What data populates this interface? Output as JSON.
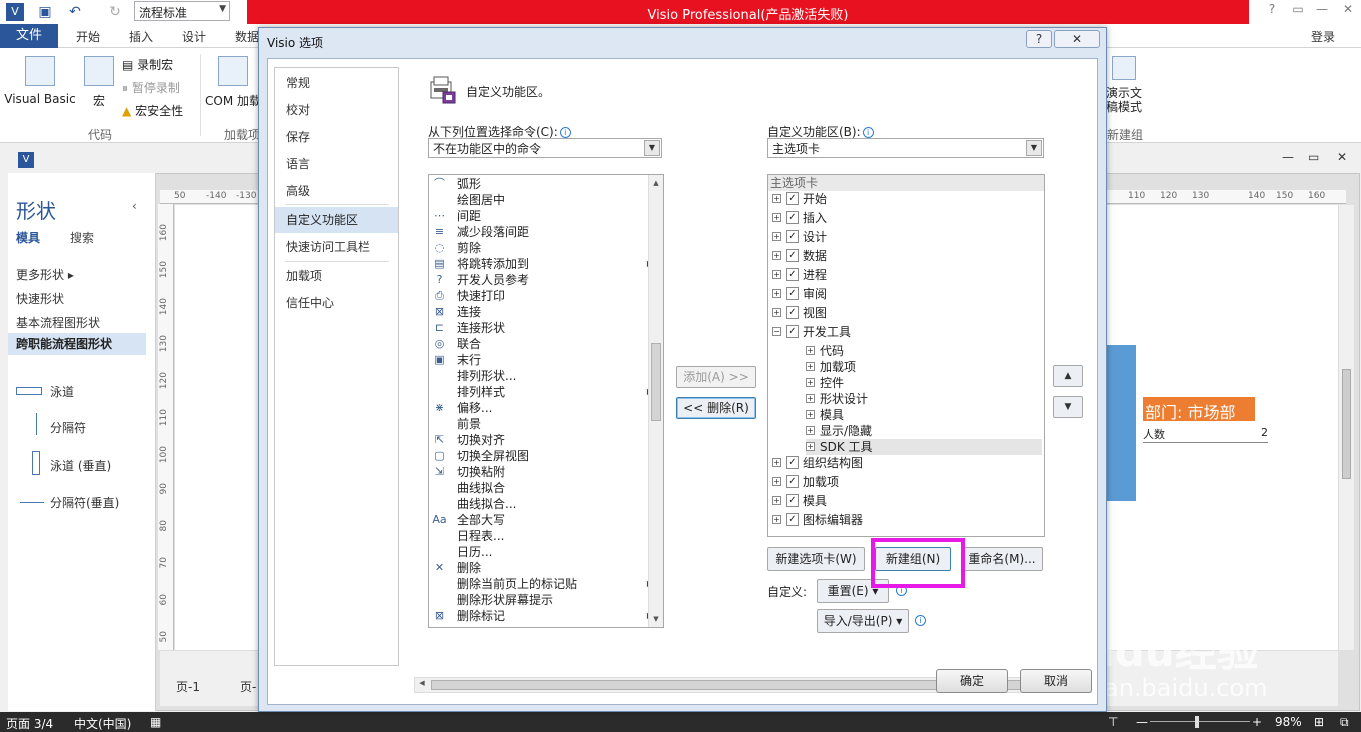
{
  "app": {
    "window_title": "Visio Professional(产品激活失败)",
    "quick_style": "流程标准",
    "ribbon_tabs": [
      "开始",
      "插入",
      "设计",
      "数据"
    ],
    "file_tab": "文件",
    "login": "登录"
  },
  "ribbon": {
    "visual_basic": "Visual Basic",
    "macro": "宏",
    "record_macro": "录制宏",
    "pause_record": "暂停录制",
    "macro_security": "宏安全性",
    "com_addins": "COM 加载",
    "group_code": "代码",
    "group_addins": "加载项",
    "present_mode": "演示文稿模式",
    "new_group_label": "新建组"
  },
  "shapes_panel": {
    "title": "形状",
    "tab_stencils": "模具",
    "tab_search": "搜索",
    "more_shapes": "更多形状",
    "quick_shapes": "快速形状",
    "basic_flowchart": "基本流程图形状",
    "cross_functional": "跨职能流程图形状",
    "items": [
      "泳道",
      "分隔符",
      "泳道 (垂直)",
      "分隔符(垂直)"
    ]
  },
  "canvas": {
    "ruler_top": [
      "50",
      "-140",
      "-130",
      "110",
      "120",
      "130",
      "140",
      "150",
      "160"
    ],
    "ruler_left": [
      "160",
      "150",
      "140",
      "130",
      "120",
      "110",
      "100",
      "90",
      "80",
      "70",
      "60",
      "50"
    ],
    "dept_label": "部门:  市场部",
    "count_label": "人数",
    "count_value": "2",
    "page_tabs": [
      "页-1",
      "页-"
    ]
  },
  "statusbar": {
    "page": "页面 3/4",
    "language": "中文(中国)",
    "zoom": "98%"
  },
  "dialog": {
    "title": "Visio 选项",
    "help": "?",
    "close": "✕",
    "nav": [
      "常规",
      "校对",
      "保存",
      "语言",
      "高级",
      "自定义功能区",
      "快速访问工具栏",
      "加载项",
      "信任中心"
    ],
    "nav_selected": "自定义功能区",
    "heading": "自定义功能区。",
    "choose_from_label": "从下列位置选择命令(C):",
    "choose_from_value": "不在功能区中的命令",
    "customize_label": "自定义功能区(B):",
    "customize_value": "主选项卡",
    "commands": [
      {
        "icon": "⌒",
        "label": "弧形",
        "sub": false
      },
      {
        "icon": "",
        "label": "绘图居中",
        "sub": false
      },
      {
        "icon": "⋯",
        "label": "间距",
        "sub": false
      },
      {
        "icon": "≡",
        "label": "减少段落间距",
        "sub": false
      },
      {
        "icon": "◌",
        "label": "剪除",
        "sub": false
      },
      {
        "icon": "▤",
        "label": "将跳转添加到",
        "sub": true
      },
      {
        "icon": "?",
        "label": "开发人员参考",
        "sub": false
      },
      {
        "icon": "⎙",
        "label": "快速打印",
        "sub": false
      },
      {
        "icon": "⊠",
        "label": "连接",
        "sub": false
      },
      {
        "icon": "⊏",
        "label": "连接形状",
        "sub": false
      },
      {
        "icon": "◎",
        "label": "联合",
        "sub": false
      },
      {
        "icon": "▣",
        "label": "末行",
        "sub": false
      },
      {
        "icon": "",
        "label": "排列形状...",
        "sub": false
      },
      {
        "icon": "",
        "label": "排列样式",
        "sub": true
      },
      {
        "icon": "⋇",
        "label": "偏移...",
        "sub": false
      },
      {
        "icon": "",
        "label": "前景",
        "sub": false
      },
      {
        "icon": "⇱",
        "label": "切换对齐",
        "sub": false
      },
      {
        "icon": "▢",
        "label": "切换全屏视图",
        "sub": false
      },
      {
        "icon": "⇲",
        "label": "切换粘附",
        "sub": false
      },
      {
        "icon": "",
        "label": "曲线拟合",
        "sub": false
      },
      {
        "icon": "",
        "label": "曲线拟合...",
        "sub": false
      },
      {
        "icon": "Aa",
        "label": "全部大写",
        "sub": false
      },
      {
        "icon": "",
        "label": "日程表...",
        "sub": false
      },
      {
        "icon": "",
        "label": "日历...",
        "sub": false
      },
      {
        "icon": "✕",
        "label": "删除",
        "sub": false
      },
      {
        "icon": "",
        "label": "删除当前页上的标记贴",
        "sub": true
      },
      {
        "icon": "",
        "label": "删除形状屏幕提示",
        "sub": false
      },
      {
        "icon": "⊠",
        "label": "删除标记",
        "sub": true
      }
    ],
    "add_button": "添加(A) >>",
    "remove_button": "<< 删除(R)",
    "tree_header": "主选项卡",
    "tree": [
      {
        "level": 0,
        "pm": "+",
        "checked": true,
        "label": "开始"
      },
      {
        "level": 0,
        "pm": "+",
        "checked": true,
        "label": "插入"
      },
      {
        "level": 0,
        "pm": "+",
        "checked": true,
        "label": "设计"
      },
      {
        "level": 0,
        "pm": "+",
        "checked": true,
        "label": "数据"
      },
      {
        "level": 0,
        "pm": "+",
        "checked": true,
        "label": "进程"
      },
      {
        "level": 0,
        "pm": "+",
        "checked": true,
        "label": "审阅"
      },
      {
        "level": 0,
        "pm": "+",
        "checked": true,
        "label": "视图"
      },
      {
        "level": 0,
        "pm": "−",
        "checked": true,
        "label": "开发工具"
      },
      {
        "level": 1,
        "pm": "+",
        "checked": null,
        "label": "代码"
      },
      {
        "level": 1,
        "pm": "+",
        "checked": null,
        "label": "加载项"
      },
      {
        "level": 1,
        "pm": "+",
        "checked": null,
        "label": "控件"
      },
      {
        "level": 1,
        "pm": "+",
        "checked": null,
        "label": "形状设计"
      },
      {
        "level": 1,
        "pm": "+",
        "checked": null,
        "label": "模具"
      },
      {
        "level": 1,
        "pm": "+",
        "checked": null,
        "label": "显示/隐藏"
      },
      {
        "level": 1,
        "pm": "+",
        "checked": null,
        "label": "SDK 工具",
        "highlight": true
      },
      {
        "level": 0,
        "pm": "+",
        "checked": true,
        "label": "组织结构图"
      },
      {
        "level": 0,
        "pm": "+",
        "checked": true,
        "label": "加载项"
      },
      {
        "level": 0,
        "pm": "+",
        "checked": true,
        "label": "模具"
      },
      {
        "level": 0,
        "pm": "+",
        "checked": true,
        "label": "图标编辑器"
      }
    ],
    "new_tab_button": "新建选项卡(W)",
    "new_group_button": "新建组(N)",
    "rename_button": "重命名(M)...",
    "customize_label2": "自定义:",
    "reset_button": "重置(E) ▾",
    "import_export_button": "导入/导出(P) ▾",
    "ok_button": "确定",
    "cancel_button": "取消"
  },
  "watermark": {
    "brand": "Baidu经验",
    "url": "jingyan.baidu.com"
  }
}
